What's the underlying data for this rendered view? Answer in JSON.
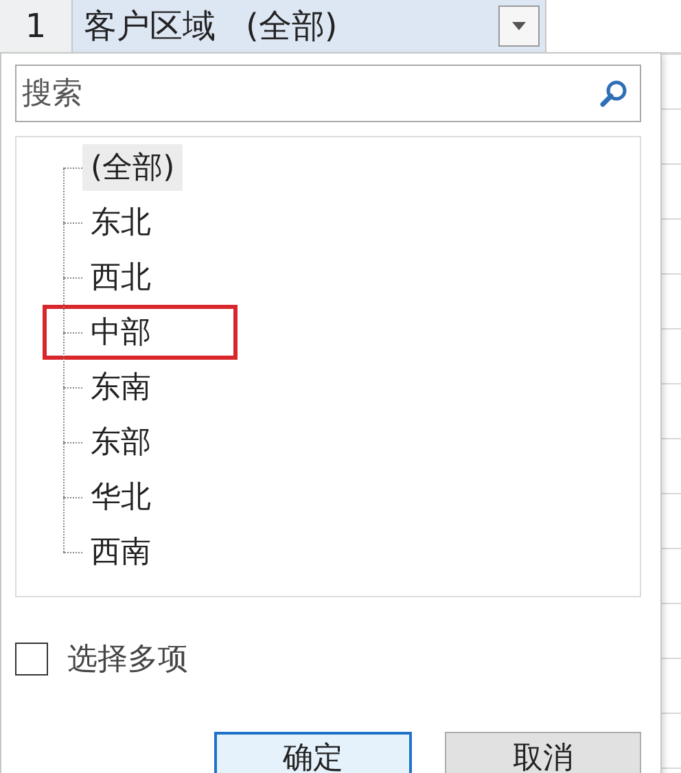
{
  "header": {
    "row_number": "1",
    "field_label": "客户区域",
    "filter_value": "(全部)"
  },
  "search": {
    "placeholder": "搜索"
  },
  "items": [
    {
      "label": "(全部)",
      "selected": true,
      "highlighted": false
    },
    {
      "label": "东北",
      "selected": false,
      "highlighted": false
    },
    {
      "label": "西北",
      "selected": false,
      "highlighted": false
    },
    {
      "label": "中部",
      "selected": false,
      "highlighted": true
    },
    {
      "label": "东南",
      "selected": false,
      "highlighted": false
    },
    {
      "label": "东部",
      "selected": false,
      "highlighted": false
    },
    {
      "label": "华北",
      "selected": false,
      "highlighted": false
    },
    {
      "label": "西南",
      "selected": false,
      "highlighted": false
    }
  ],
  "multi_select": {
    "label": "选择多项",
    "checked": false
  },
  "buttons": [
    {
      "label": "确定",
      "kind": "primary"
    },
    {
      "label": "取消",
      "kind": "secondary"
    }
  ]
}
